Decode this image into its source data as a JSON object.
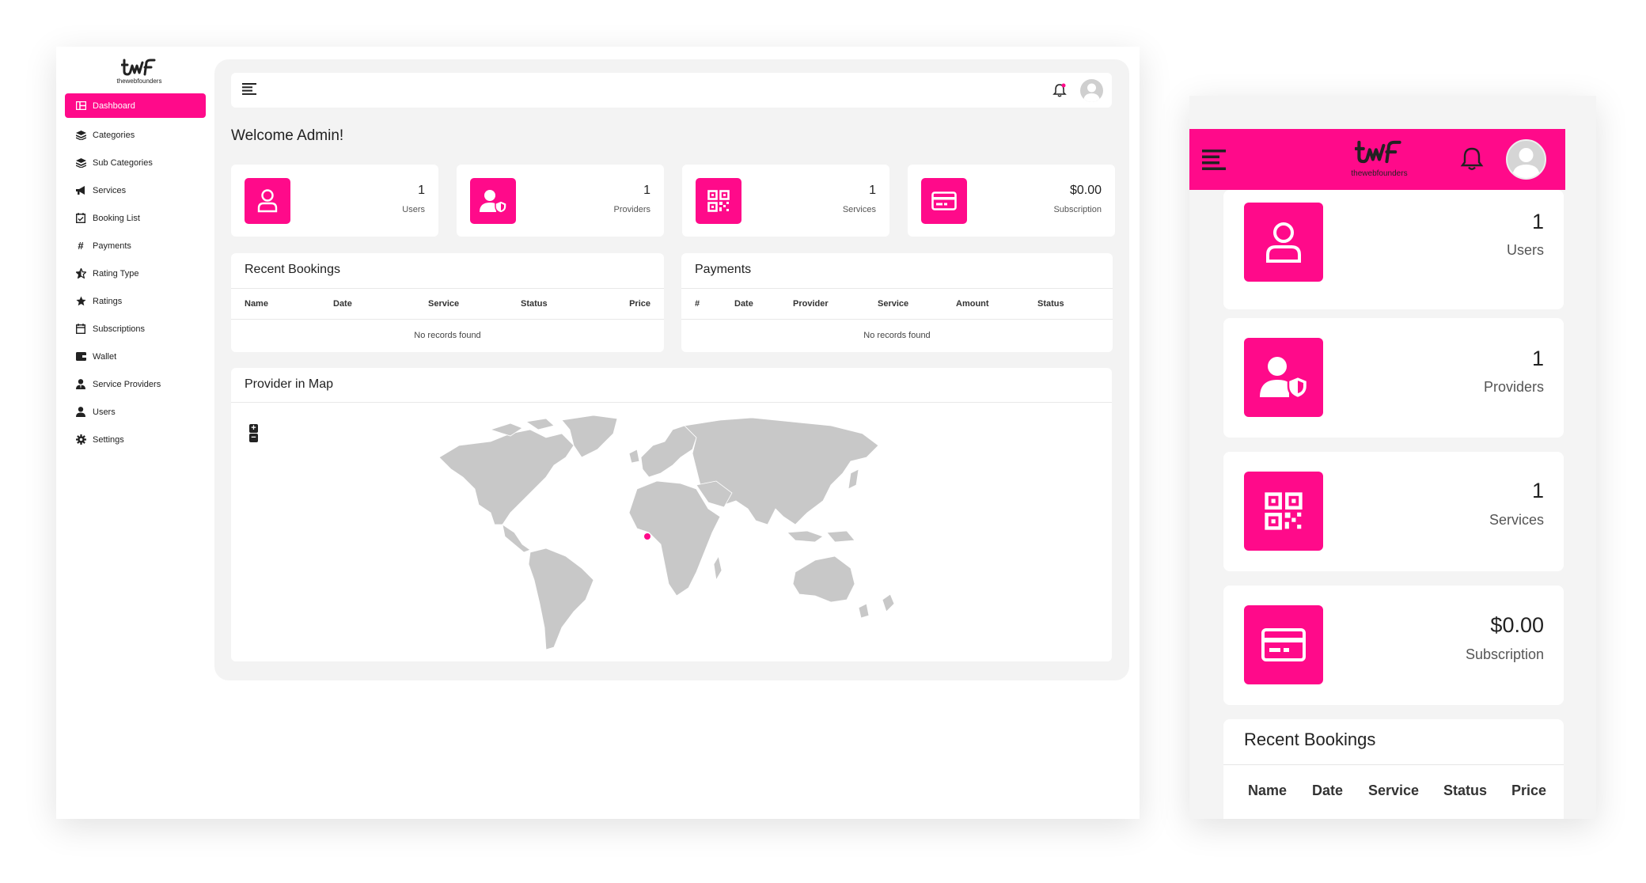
{
  "brand": {
    "logo_text": "thewebfounders",
    "accent": "#ff0a8a"
  },
  "sidebar": {
    "items": [
      {
        "label": "Dashboard",
        "icon": "dashboard-icon"
      },
      {
        "label": "Categories",
        "icon": "layers-icon"
      },
      {
        "label": "Sub Categories",
        "icon": "layers-icon"
      },
      {
        "label": "Services",
        "icon": "megaphone-icon"
      },
      {
        "label": "Booking List",
        "icon": "calendar-check-icon"
      },
      {
        "label": "Payments",
        "icon": "hash-icon"
      },
      {
        "label": "Rating Type",
        "icon": "star-half-icon"
      },
      {
        "label": "Ratings",
        "icon": "star-icon"
      },
      {
        "label": "Subscriptions",
        "icon": "calendar-icon"
      },
      {
        "label": "Wallet",
        "icon": "wallet-icon"
      },
      {
        "label": "Service Providers",
        "icon": "user-tie-icon"
      },
      {
        "label": "Users",
        "icon": "user-icon"
      },
      {
        "label": "Settings",
        "icon": "gear-icon"
      }
    ]
  },
  "header": {
    "welcome": "Welcome Admin!"
  },
  "stats": [
    {
      "value": "1",
      "label": "Users",
      "icon": "user-outline-icon"
    },
    {
      "value": "1",
      "label": "Providers",
      "icon": "user-shield-icon"
    },
    {
      "value": "1",
      "label": "Services",
      "icon": "qr-code-icon"
    },
    {
      "value": "$0.00",
      "label": "Subscription",
      "icon": "credit-card-icon"
    }
  ],
  "recent_bookings": {
    "title": "Recent Bookings",
    "columns": [
      "Name",
      "Date",
      "Service",
      "Status",
      "Price"
    ],
    "empty_text": "No records found"
  },
  "payments": {
    "title": "Payments",
    "columns": [
      "#",
      "Date",
      "Provider",
      "Service",
      "Amount",
      "Status"
    ],
    "empty_text": "No records found"
  },
  "map": {
    "title": "Provider in Map",
    "zoom_in": "+",
    "zoom_out": "−"
  },
  "mobile": {
    "stats": [
      {
        "value": "1",
        "label": "Users"
      },
      {
        "value": "1",
        "label": "Providers"
      },
      {
        "value": "1",
        "label": "Services"
      },
      {
        "value": "$0.00",
        "label": "Subscription"
      }
    ],
    "recent_bookings": {
      "title": "Recent Bookings",
      "columns": [
        "Name",
        "Date",
        "Service",
        "Status",
        "Price"
      ]
    }
  }
}
